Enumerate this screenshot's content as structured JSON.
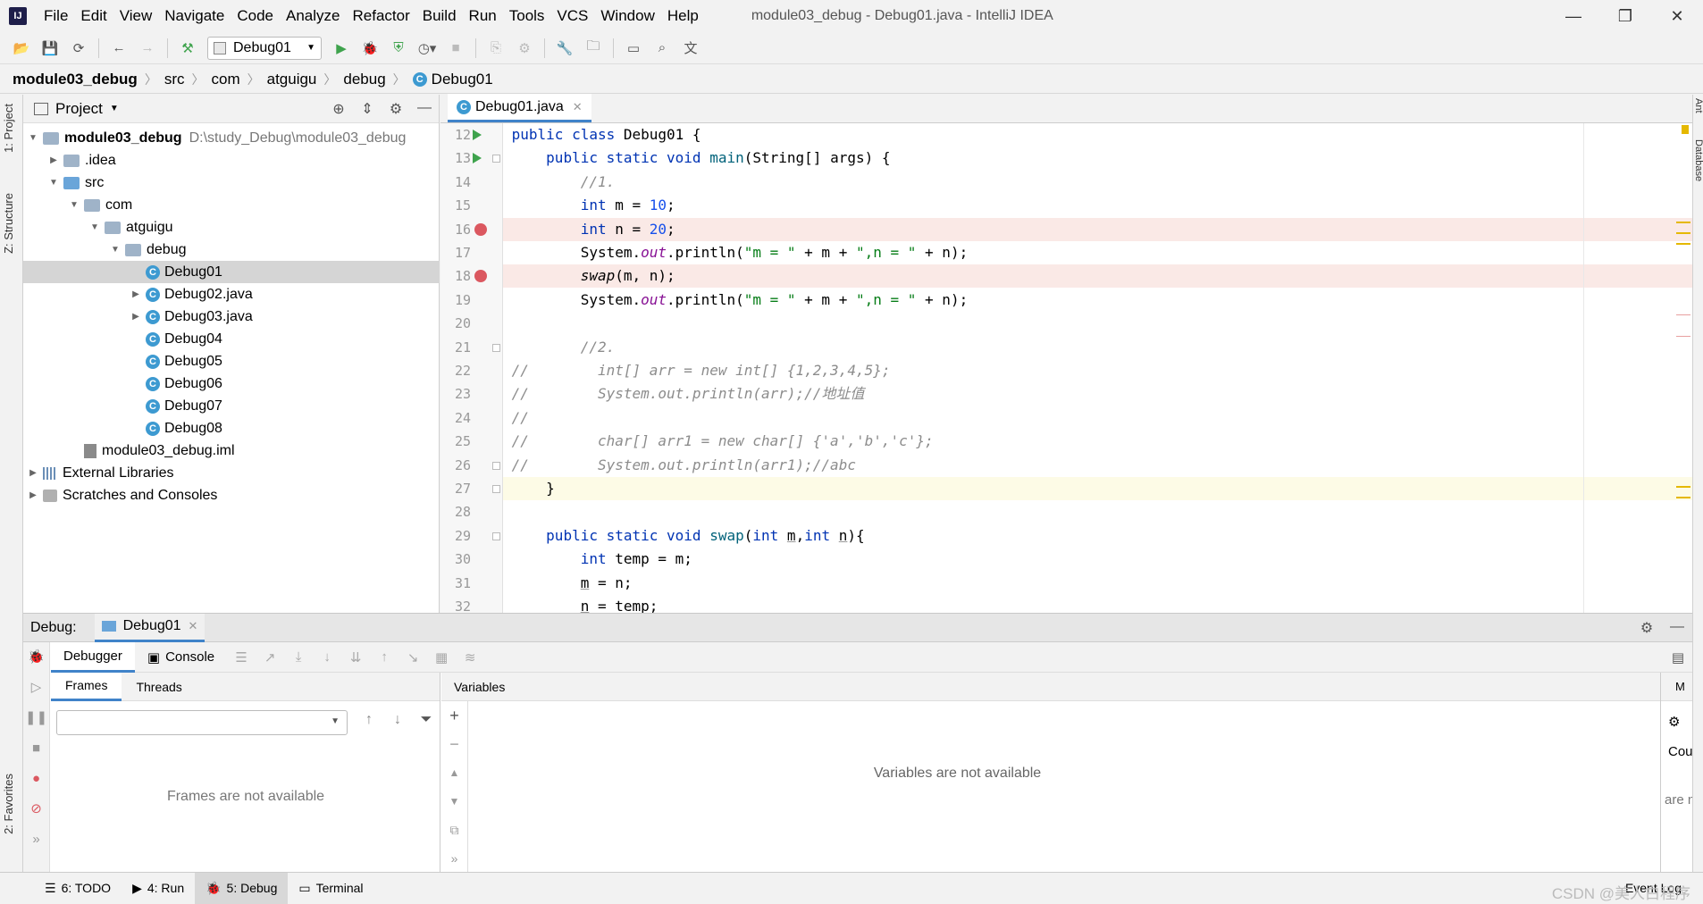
{
  "app": {
    "window_title": "module03_debug - Debug01.java - IntelliJ IDEA",
    "logo_text": "IJ"
  },
  "menu": [
    "File",
    "Edit",
    "View",
    "Navigate",
    "Code",
    "Analyze",
    "Refactor",
    "Build",
    "Run",
    "Tools",
    "VCS",
    "Window",
    "Help"
  ],
  "toolbar": {
    "run_config": "Debug01"
  },
  "breadcrumb": [
    "module03_debug",
    "src",
    "com",
    "atguigu",
    "debug",
    "Debug01"
  ],
  "left_tabs": {
    "project": "1: Project",
    "structure": "Z: Structure",
    "favorites": "2: Favorites"
  },
  "right_tabs": {
    "ant": "Ant",
    "database": "Database"
  },
  "project": {
    "title": "Project",
    "tree": [
      {
        "label": "module03_debug",
        "path": "D:\\study_Debug\\module03_debug",
        "indent": 0,
        "arrow": "▼",
        "icon": "module",
        "bold": true
      },
      {
        "label": ".idea",
        "indent": 1,
        "arrow": "▶",
        "icon": "folder"
      },
      {
        "label": "src",
        "indent": 1,
        "arrow": "▼",
        "icon": "src"
      },
      {
        "label": "com",
        "indent": 2,
        "arrow": "▼",
        "icon": "package"
      },
      {
        "label": "atguigu",
        "indent": 3,
        "arrow": "▼",
        "icon": "package"
      },
      {
        "label": "debug",
        "indent": 4,
        "arrow": "▼",
        "icon": "package"
      },
      {
        "label": "Debug01",
        "indent": 5,
        "arrow": "",
        "icon": "class",
        "selected": true
      },
      {
        "label": "Debug02.java",
        "indent": 5,
        "arrow": "▶",
        "icon": "class"
      },
      {
        "label": "Debug03.java",
        "indent": 5,
        "arrow": "▶",
        "icon": "class"
      },
      {
        "label": "Debug04",
        "indent": 5,
        "arrow": "",
        "icon": "class"
      },
      {
        "label": "Debug05",
        "indent": 5,
        "arrow": "",
        "icon": "class"
      },
      {
        "label": "Debug06",
        "indent": 5,
        "arrow": "",
        "icon": "class"
      },
      {
        "label": "Debug07",
        "indent": 5,
        "arrow": "",
        "icon": "class"
      },
      {
        "label": "Debug08",
        "indent": 5,
        "arrow": "",
        "icon": "class"
      },
      {
        "label": "module03_debug.iml",
        "indent": 2,
        "arrow": "",
        "icon": "iml"
      },
      {
        "label": "External Libraries",
        "indent": 0,
        "arrow": "▶",
        "icon": "lib"
      },
      {
        "label": "Scratches and Consoles",
        "indent": 0,
        "arrow": "▶",
        "icon": "scratch"
      }
    ]
  },
  "editor": {
    "tab_label": "Debug01.java",
    "lines": [
      {
        "n": "12",
        "run": true,
        "html": "<span class=\"kw\">public class</span> Debug01 {"
      },
      {
        "n": "13",
        "run": true,
        "fold": true,
        "html": "    <span class=\"kw\">public static void</span> <span class=\"mth\">main</span>(String[] args) {"
      },
      {
        "n": "14",
        "html": "        <span class=\"cmt\">//1.</span>"
      },
      {
        "n": "15",
        "html": "        <span class=\"kw\">int</span> m = <span class=\"num\">10</span>;"
      },
      {
        "n": "16",
        "bp": true,
        "html": "        <span class=\"kw\">int</span> n = <span class=\"num\">20</span>;"
      },
      {
        "n": "17",
        "html": "        System.<span class=\"sf\">out</span>.println(<span class=\"str\">\"m = \"</span> + m + <span class=\"str\">\",n = \"</span> + n);"
      },
      {
        "n": "18",
        "bp": true,
        "html": "        <span class=\"it\">swap</span>(m, n);"
      },
      {
        "n": "19",
        "html": "        System.<span class=\"sf\">out</span>.println(<span class=\"str\">\"m = \"</span> + m + <span class=\"str\">\",n = \"</span> + n);"
      },
      {
        "n": "20",
        "html": ""
      },
      {
        "n": "21",
        "fold": true,
        "html": "        <span class=\"cmt\">//2.</span>"
      },
      {
        "n": "22",
        "html": "<span class=\"cmt\">//        int[] arr = new int[] {1,2,3,4,5};</span>"
      },
      {
        "n": "23",
        "html": "<span class=\"cmt\">//        System.out.println(arr);//地址值</span>"
      },
      {
        "n": "24",
        "html": "<span class=\"cmt\">//</span>"
      },
      {
        "n": "25",
        "html": "<span class=\"cmt\">//        char[] arr1 = new char[] {'a','b','c'};</span>"
      },
      {
        "n": "26",
        "fold": true,
        "html": "<span class=\"cmt\">//        System.out.println(arr1);//abc</span>"
      },
      {
        "n": "27",
        "fold": true,
        "cur": true,
        "html": "    }"
      },
      {
        "n": "28",
        "html": ""
      },
      {
        "n": "29",
        "fold": true,
        "html": "    <span class=\"kw\">public static void</span> <span class=\"mth\">swap</span>(<span class=\"kw\">int</span> <span class=\"ul\">m</span>,<span class=\"kw\">int</span> <span class=\"ul\">n</span>){"
      },
      {
        "n": "30",
        "html": "        <span class=\"kw\">int</span> temp = m;"
      },
      {
        "n": "31",
        "html": "        <span class=\"ul\">m</span> = n;"
      },
      {
        "n": "32",
        "html": "        <span class=\"ul\">n</span> = temp;"
      }
    ]
  },
  "debug": {
    "label": "Debug:",
    "session_tab": "Debug01",
    "debugger_tab": "Debugger",
    "console_tab": "Console",
    "frames_tab": "Frames",
    "threads_tab": "Threads",
    "frames_empty": "Frames are not available",
    "variables_header": "Variables",
    "variables_empty": "Variables are not available",
    "watch_header": "M",
    "watch_col": "Cou",
    "watch_empty": "are not a"
  },
  "statusbar": {
    "todo": "6: TODO",
    "run": "4: Run",
    "debug": "5: Debug",
    "terminal": "Terminal",
    "event_log": "Event Log",
    "watermark": "CSDN @美人白程序"
  }
}
